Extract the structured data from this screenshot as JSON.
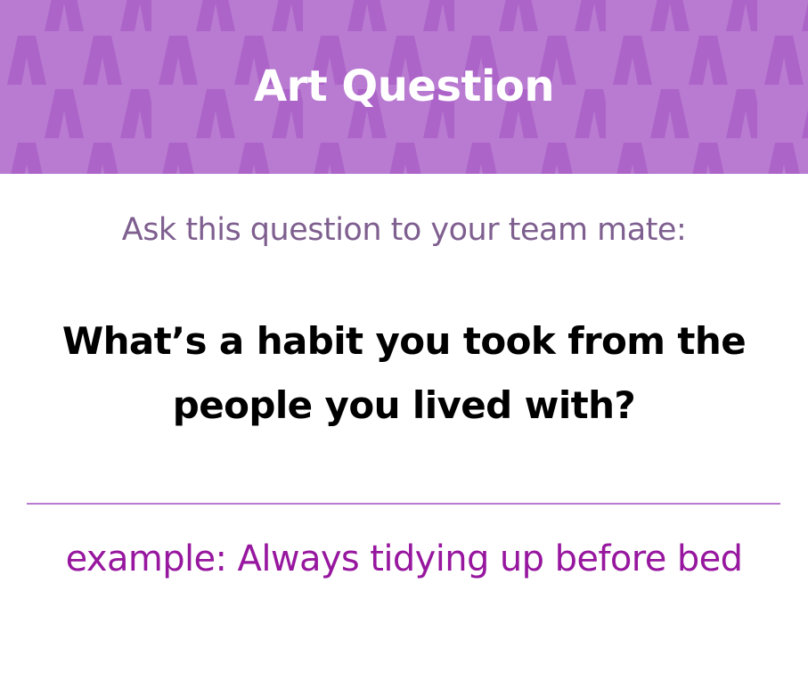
{
  "header": {
    "title": "Art Question",
    "background_color": "#b97bd1",
    "pattern_color": "#ac64c8",
    "pattern_glyph": "A"
  },
  "prompt": {
    "text": "Ask this question to your team mate:",
    "color": "#7e5f8f"
  },
  "question": {
    "text": "What’s a habit you took from the people you lived with?",
    "color": "#000000"
  },
  "divider": {
    "color": "#b97bd1"
  },
  "example": {
    "text": "example: Always tidying up before bed",
    "color": "#97179f"
  }
}
